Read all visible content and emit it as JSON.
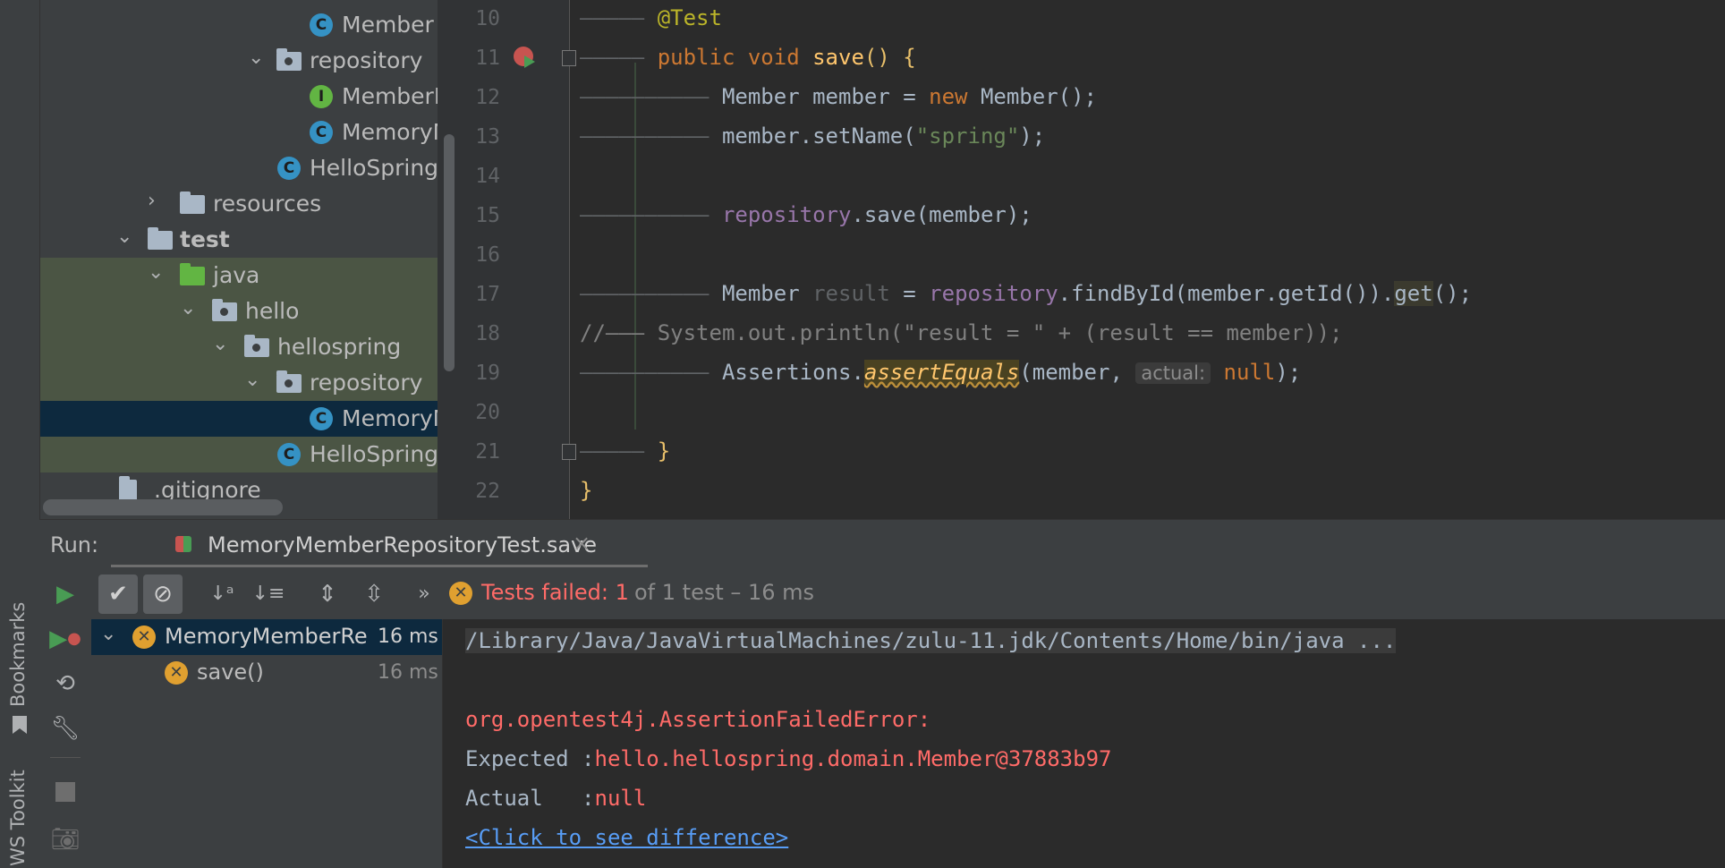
{
  "side_strip": {
    "bookmarks_label": "Bookmarks",
    "aws_label": "WS Toolkit"
  },
  "project_tree": [
    {
      "label": "Member",
      "kind": "class"
    },
    {
      "label": "repository",
      "kind": "package"
    },
    {
      "label": "MemberF",
      "kind": "interface"
    },
    {
      "label": "MemoryM",
      "kind": "class"
    },
    {
      "label": "HelloSpring.",
      "kind": "app-class"
    },
    {
      "label": "resources",
      "kind": "folder"
    },
    {
      "label": "test",
      "kind": "folder"
    },
    {
      "label": "java",
      "kind": "source-folder"
    },
    {
      "label": "hello",
      "kind": "package"
    },
    {
      "label": "hellospring",
      "kind": "package"
    },
    {
      "label": "repository",
      "kind": "package"
    },
    {
      "label": "MemoryM",
      "kind": "test-class"
    },
    {
      "label": "HelloSpring.",
      "kind": "test-class"
    },
    {
      "label": ".gitignore",
      "kind": "file"
    }
  ],
  "editor": {
    "line_numbers": [
      "10",
      "11",
      "12",
      "13",
      "14",
      "15",
      "16",
      "17",
      "18",
      "19",
      "20",
      "21",
      "22"
    ],
    "l10": {
      "ann": "@Test"
    },
    "l11": {
      "kw1": "public",
      "kw2": "void",
      "fn": "save",
      "rest": "() {"
    },
    "l12": {
      "a": "Member member = ",
      "kw": "new",
      "b": " Member();"
    },
    "l13": {
      "a": "member.setName(",
      "str": "\"spring\"",
      "b": ");"
    },
    "l15": {
      "fld": "repository",
      "b": ".save(member);"
    },
    "l17": {
      "a": "Member ",
      "gy": "result",
      "b": " = ",
      "fld": "repository",
      "c": ".findById(member.getId()).",
      "get": "get",
      "d": "();"
    },
    "l18": {
      "text": "//——— System.out.println(\"result = \" + (result == member));"
    },
    "l19": {
      "a": "Assertions.",
      "warn": "assertEquals",
      "b": "(member, ",
      "hint": "actual:",
      "kw": "null",
      "c": ");"
    },
    "l21": {
      "brace": "}"
    },
    "l22": {
      "brace": "}"
    }
  },
  "run_panel": {
    "run_label": "Run:",
    "tab_title": "MemoryMemberRepositoryTest.save",
    "status_failed": "Tests failed: 1",
    "status_rest": "of 1 test – 16 ms",
    "test_tree": [
      {
        "label": "MemoryMemberRe",
        "time": "16 ms"
      },
      {
        "label": "save()",
        "time": "16 ms"
      }
    ]
  },
  "console": {
    "cmd": "/Library/Java/JavaVirtualMachines/zulu-11.jdk/Contents/Home/bin/java ...",
    "error": "org.opentest4j.AssertionFailedError: ",
    "expected_label": "Expected :",
    "expected_value": "hello.hellospring.domain.Member@37883b97",
    "actual_label": "Actual   :",
    "actual_value": "null",
    "diff_link": "<Click to see difference>"
  },
  "colors": {
    "error": "#ff6b68",
    "keyword": "#cc7832",
    "annotation": "#bbb529",
    "method": "#ffc66d",
    "string": "#6a8759",
    "field": "#9876aa"
  }
}
